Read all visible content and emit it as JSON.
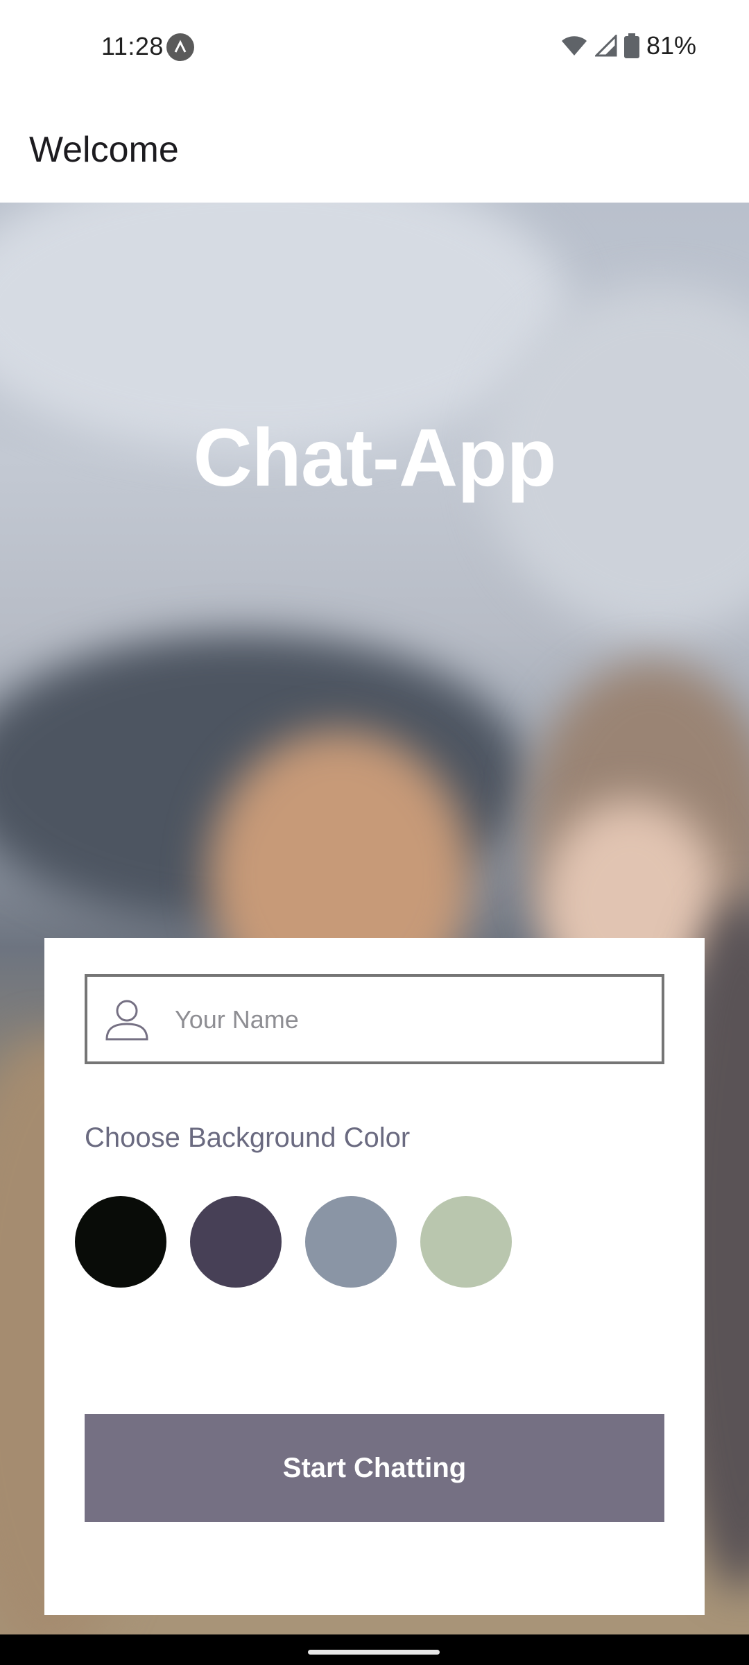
{
  "status_bar": {
    "time": "11:28",
    "battery_text": "81%",
    "icons": [
      "app-notification-icon",
      "wifi-icon",
      "cellular-signal-icon",
      "battery-icon"
    ]
  },
  "app_bar": {
    "title": "Welcome"
  },
  "hero": {
    "app_name": "Chat-App"
  },
  "form": {
    "name_field": {
      "placeholder": "Your Name",
      "value": "",
      "icon": "person-icon"
    },
    "background_label": "Choose Background Color",
    "colors": [
      {
        "name": "black",
        "hex": "#090C08"
      },
      {
        "name": "purple",
        "hex": "#474056"
      },
      {
        "name": "grey-blue",
        "hex": "#8A95A5"
      },
      {
        "name": "sage-green",
        "hex": "#B9C6AE"
      }
    ],
    "start_button_label": "Start Chatting",
    "start_button_color": "#757083"
  }
}
